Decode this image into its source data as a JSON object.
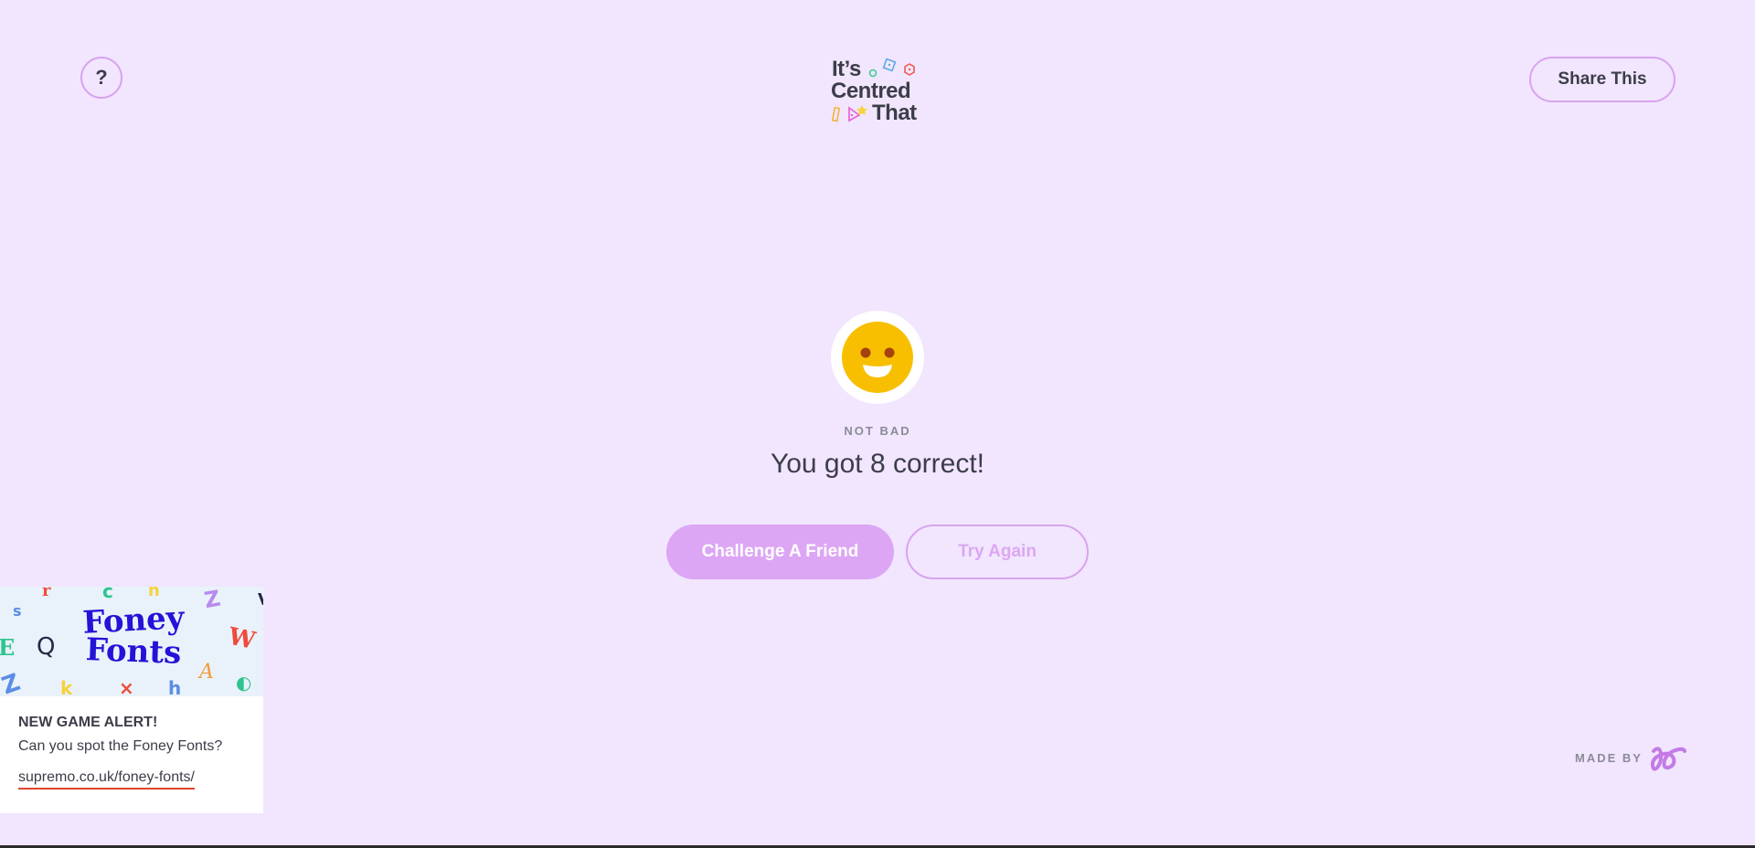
{
  "header": {
    "help_label": "?",
    "share_label": "Share This",
    "logo": {
      "line1": "It’s",
      "line2": "Centred",
      "line3": "That"
    }
  },
  "result": {
    "rating": "NOT BAD",
    "score_text": "You got 8 correct!",
    "face_icon": "smiley-face-icon"
  },
  "actions": {
    "challenge_label": "Challenge A Friend",
    "try_again_label": "Try Again"
  },
  "promo": {
    "banner_title_line1": "Foney",
    "banner_title_line2": "Fonts",
    "alert": "NEW GAME ALERT!",
    "question": "Can you spot the Foney Fonts?",
    "link_text": "supremo.co.uk/foney-fonts/"
  },
  "footer": {
    "made_by_label": "MADE BY"
  },
  "colors": {
    "background": "#f1e6fd",
    "accent": "#dca6f4",
    "accent_border": "#d9a3ef",
    "text": "#3d3d4a",
    "muted": "#8b8b98",
    "smiley": "#f8bf00",
    "link_underline": "#e2442f"
  }
}
